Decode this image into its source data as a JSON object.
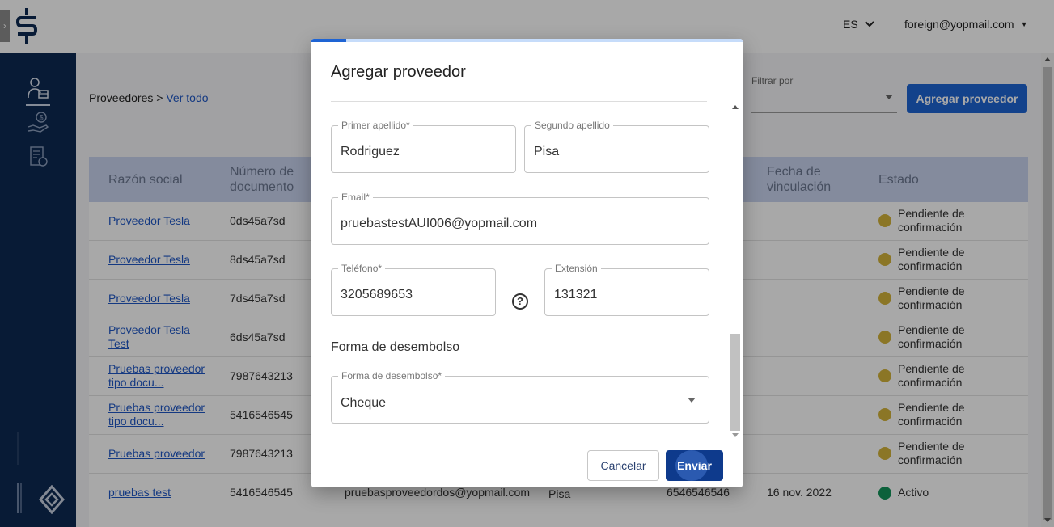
{
  "header": {
    "expand_glyph": "›",
    "language": "ES",
    "user_email": "foreign@yopmail.com"
  },
  "sidebar": {
    "items": [
      {
        "icon": "supplier-icon",
        "active": true
      },
      {
        "icon": "money-hand-icon",
        "active": false
      },
      {
        "icon": "invoice-icon",
        "active": false
      }
    ]
  },
  "main": {
    "breadcrumb": {
      "parent": "Proveedores",
      "separator": " > ",
      "current": "Ver todo"
    },
    "filter": {
      "label": "Filtrar por",
      "value": ""
    },
    "add_button": "Agregar proveedor",
    "table": {
      "columns": [
        "Razón social",
        "Número de documento",
        "Fecha de vinculación",
        "Estado"
      ],
      "rows": [
        {
          "name": "Proveedor Tesla",
          "doc": "0ds45a7sd",
          "email": "",
          "contact": "",
          "phone": "",
          "date": "",
          "status": "Pendiente de confirmación",
          "status_color": "#d4b43a"
        },
        {
          "name": "Proveedor Tesla",
          "doc": "8ds45a7sd",
          "email": "",
          "contact": "",
          "phone": "",
          "date": "",
          "status": "Pendiente de confirmación",
          "status_color": "#d4b43a"
        },
        {
          "name": "Proveedor Tesla",
          "doc": "7ds45a7sd",
          "email": "",
          "contact": "",
          "phone": "",
          "date": "",
          "status": "Pendiente de confirmación",
          "status_color": "#d4b43a"
        },
        {
          "name": "Proveedor Tesla Test",
          "doc": "6ds45a7sd",
          "email": "",
          "contact": "",
          "phone": "",
          "date": "",
          "status": "Pendiente de confirmación",
          "status_color": "#d4b43a"
        },
        {
          "name": "Pruebas proveedor tipo docu...",
          "doc": "7987643213",
          "email": "",
          "contact": "",
          "phone": "",
          "date": "",
          "status": "Pendiente de confirmación",
          "status_color": "#d4b43a"
        },
        {
          "name": "Pruebas proveedor tipo docu...",
          "doc": "5416546545",
          "email": "",
          "contact": "",
          "phone": "",
          "date": "",
          "status": "Pendiente de confirmación",
          "status_color": "#d4b43a"
        },
        {
          "name": "Pruebas proveedor",
          "doc": "7987643213",
          "email": "",
          "contact": "",
          "phone": "",
          "date": "",
          "status": "Pendiente de confirmación",
          "status_color": "#d4b43a"
        },
        {
          "name": "pruebas test",
          "doc": "5416546545",
          "email": "pruebasproveedordos@yopmail.com",
          "contact": "Andres rodriguez Pisa",
          "phone": "6546546546",
          "date": "16 nov. 2022",
          "status": "Activo",
          "status_color": "#13935a"
        }
      ]
    }
  },
  "dialog": {
    "title": "Agregar proveedor",
    "progress_fraction": 0.08,
    "fields": {
      "primer_apellido": {
        "label": "Primer apellido*",
        "value": "Rodriguez"
      },
      "segundo_apellido": {
        "label": "Segundo apellido",
        "value": "Pisa"
      },
      "email": {
        "label": "Email*",
        "value": "pruebastestAUI006@yopmail.com"
      },
      "telefono": {
        "label": "Teléfono*",
        "value": "3205689653"
      },
      "extension": {
        "label": "Extensión",
        "value": "131321"
      },
      "forma_desembolso": {
        "label": "Forma de desembolso*",
        "value": "Cheque"
      }
    },
    "help_glyph": "?",
    "section_title": "Forma de desembolso",
    "cancel_label": "Cancelar",
    "submit_label": "Enviar"
  },
  "colors": {
    "sidebar": "#0d2a52",
    "primary": "#1e64d4",
    "submit": "#0e3a8c",
    "table_header": "#c9d4ee",
    "pending": "#d4b43a",
    "active": "#13935a"
  }
}
